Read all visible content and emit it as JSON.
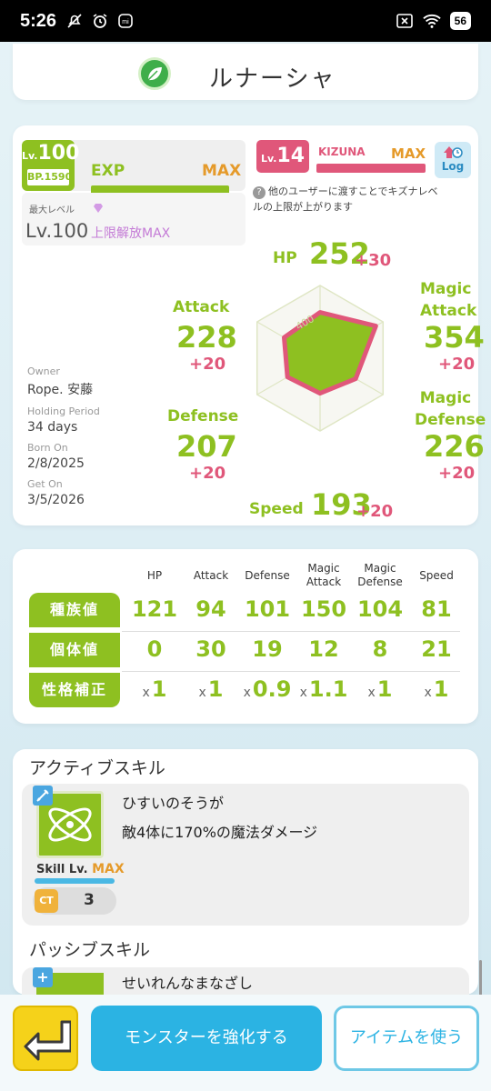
{
  "status": {
    "time": "5:26",
    "battery": "56"
  },
  "monster": {
    "name": "ルナーシャ"
  },
  "level": {
    "lv_prefix": "Lv.",
    "lv": "100",
    "bp": "BP.1590",
    "exp_label": "EXP",
    "exp_status": "MAX",
    "max_level_label": "最大レベル",
    "max_level_value": "Lv.100",
    "limit_break": "上限解放MAX"
  },
  "kizuna": {
    "lv_prefix": "Lv.",
    "lv": "14",
    "label": "KIZUNA",
    "status": "MAX",
    "log_label": "Log",
    "note": "他のユーザーに渡すことでキズナレベルの上限が上がります"
  },
  "info": {
    "owner_label": "Owner",
    "owner": "Rope. 安藤",
    "holding_label": "Holding Period",
    "holding": "34 days",
    "born_label": "Born On",
    "born": "2/8/2025",
    "get_label": "Get On",
    "get": "3/5/2026"
  },
  "stats": {
    "hp_label": "HP",
    "hp": "252",
    "hp_bonus": "+30",
    "atk_label": "Attack",
    "atk": "228",
    "atk_bonus": "+20",
    "matk_label1": "Magic",
    "matk_label2": "Attack",
    "matk": "354",
    "matk_bonus": "+20",
    "def_label": "Defense",
    "def": "207",
    "def_bonus": "+20",
    "mdef_label1": "Magic",
    "mdef_label2": "Defense",
    "mdef": "226",
    "mdef_bonus": "+20",
    "spd_label": "Speed",
    "spd": "193",
    "spd_bonus": "+20",
    "radar_tick": "400"
  },
  "radar_values": {
    "max": 400,
    "hp": 252,
    "magic_attack": 354,
    "magic_defense": 226,
    "speed": 193,
    "defense": 207,
    "attack": 228
  },
  "table": {
    "headers": [
      "HP",
      "Attack",
      "Defense",
      "Magic\nAttack",
      "Magic\nDefense",
      "Speed"
    ],
    "rows": [
      {
        "label": "種族値",
        "values": [
          "121",
          "94",
          "101",
          "150",
          "104",
          "81"
        ]
      },
      {
        "label": "個体値",
        "values": [
          "0",
          "30",
          "19",
          "12",
          "8",
          "21"
        ]
      },
      {
        "label": "性格補正",
        "prefix": "x",
        "values": [
          "1",
          "1",
          "0.9",
          "1.1",
          "1",
          "1"
        ]
      }
    ]
  },
  "skills": {
    "active_title": "アクティブスキル",
    "active_name": "ひすいのそうが",
    "active_desc": "敵4体に170%の魔法ダメージ",
    "skill_lv_label": "Skill Lv.",
    "skill_lv_value": "MAX",
    "ct_label": "CT",
    "ct_value": "3",
    "passive_title": "パッシブスキル",
    "passive_name": "せいれんなまなざし"
  },
  "actions": {
    "enhance": "モンスターを強化する",
    "use_item": "アイテムを使う"
  },
  "colors": {
    "green": "#8ec021",
    "pink": "#e0577a",
    "orange": "#e59a2a",
    "blue": "#2bb3e3"
  }
}
